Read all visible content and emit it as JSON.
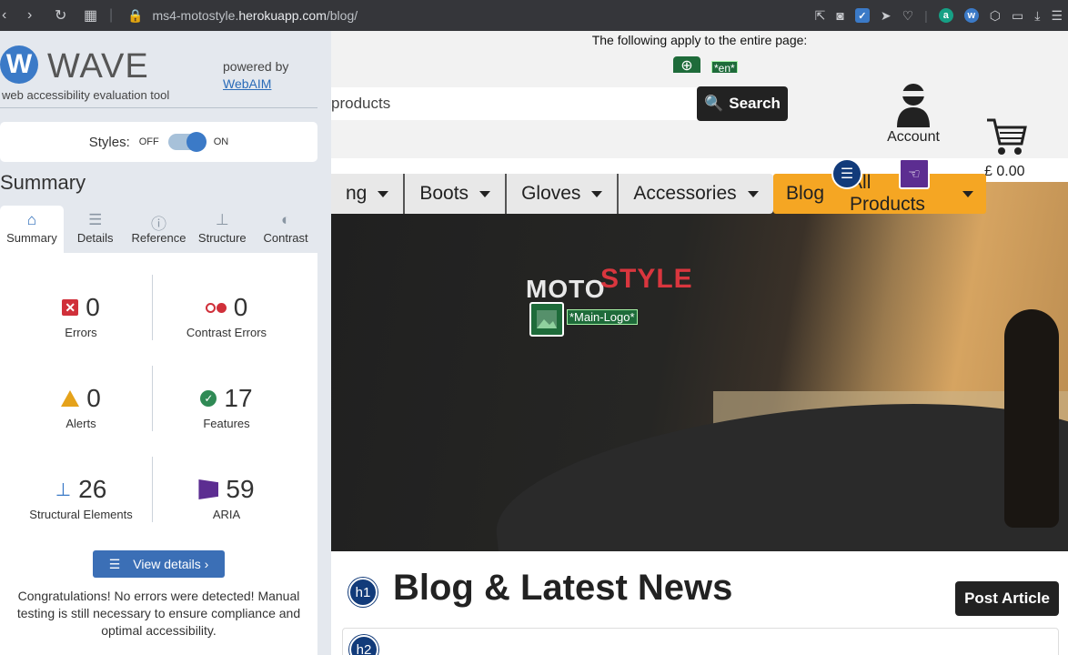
{
  "browser": {
    "url_prefix": "ms4-motostyle.",
    "url_domain": "herokuapp.com",
    "url_path": "/blog/"
  },
  "wave": {
    "logo_letter": "W",
    "logo_text": "WAVE",
    "subtitle": "web accessibility evaluation tool",
    "powered_by": "powered by",
    "webaim": "WebAIM",
    "styles_label": "Styles:",
    "off": "OFF",
    "on": "ON",
    "summary_title": "Summary",
    "tabs": [
      {
        "label": "Summary",
        "icon": "home-icon"
      },
      {
        "label": "Details",
        "icon": "list-icon"
      },
      {
        "label": "Reference",
        "icon": "info-icon"
      },
      {
        "label": "Structure",
        "icon": "hierarchy-icon"
      },
      {
        "label": "Contrast",
        "icon": "contrast-icon"
      }
    ],
    "stats": {
      "errors": {
        "value": "0",
        "label": "Errors"
      },
      "contrast_errors": {
        "value": "0",
        "label": "Contrast Errors"
      },
      "alerts": {
        "value": "0",
        "label": "Alerts"
      },
      "features": {
        "value": "17",
        "label": "Features"
      },
      "structural": {
        "value": "26",
        "label": "Structural Elements"
      },
      "aria": {
        "value": "59",
        "label": "ARIA"
      }
    },
    "view_details": "View details ›",
    "congrats": "Congratulations! No errors were detected! Manual testing is still necessary to ensure compliance and optimal accessibility."
  },
  "site": {
    "applies_text": "The following apply to the entire page:",
    "lang_tag": "*en*",
    "search_placeholder": "products",
    "search_button": "Search",
    "account": "Account",
    "cart_total": "£ 0.00",
    "nav": [
      "ng",
      "Boots",
      "Gloves",
      "Accessories"
    ],
    "nav_blog": "Blog",
    "nav_all_products": "All Products",
    "logo_moto": "MOTO",
    "logo_style": "STYLE",
    "img_tag": "*Main-Logo*",
    "h1_badge": "h1",
    "h1": "Blog & Latest News",
    "post_article": "Post Article",
    "h2_badge": "h2"
  },
  "colors": {
    "wave_blue": "#3b7ac7",
    "nav_orange": "#f5a623",
    "error_red": "#d0303a",
    "feature_green": "#2f8a55",
    "aria_purple": "#5c2d91"
  }
}
